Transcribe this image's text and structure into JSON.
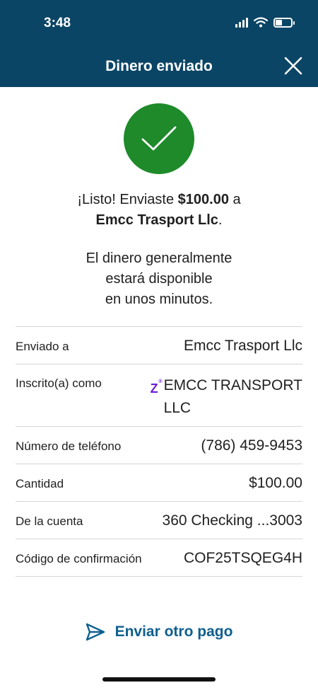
{
  "status_bar": {
    "time": "3:48"
  },
  "header": {
    "title": "Dinero enviado"
  },
  "confirmation": {
    "line1_prefix": "¡Listo! Enviaste ",
    "amount": "$100.00",
    "line1_suffix": " a",
    "recipient": "Emcc Trasport Llc",
    "period": ".",
    "availability": [
      "El dinero generalmente",
      "estará disponible",
      "en unos minutos."
    ]
  },
  "details": {
    "sent_to": {
      "label": "Enviado a",
      "value": "Emcc Trasport Llc"
    },
    "enrolled_as": {
      "label": "Inscrito(a) como",
      "value_line1": "EMCC TRANSPORT",
      "value_line2": "LLC",
      "service_glyph": "Z",
      "service_mark": "®"
    },
    "phone": {
      "label": "Número de teléfono",
      "value": "(786) 459-9453"
    },
    "amount": {
      "label": "Cantidad",
      "value": "$100.00"
    },
    "account": {
      "label": "De la cuenta",
      "value": "360 Checking ...3003"
    },
    "confirmation_code": {
      "label": "Código de confirmación",
      "value": "COF25TSQEG4H"
    }
  },
  "actions": {
    "send_another": "Enviar otro pago"
  },
  "colors": {
    "header_bg": "#0b4566",
    "success": "#1e8a2a",
    "link": "#0e5f8f",
    "zelle": "#6d1ed4"
  },
  "icons": {
    "close": "close-icon",
    "check": "checkmark-icon",
    "send": "paper-plane-icon"
  }
}
